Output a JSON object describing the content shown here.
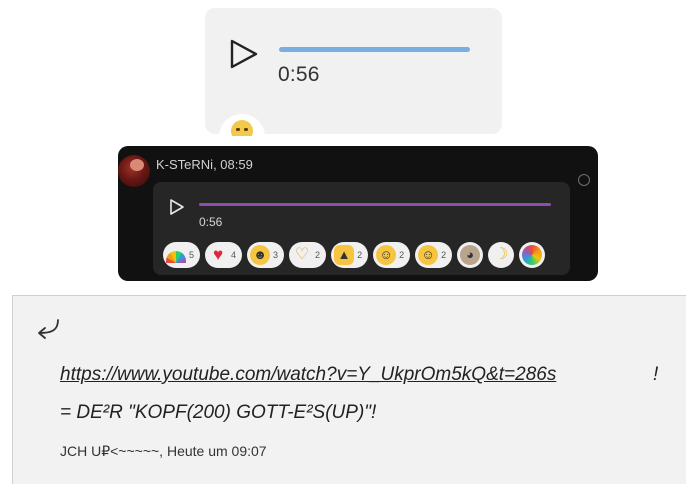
{
  "voice_light": {
    "duration": "0:56",
    "track_color": "#7aaee0"
  },
  "dark_message": {
    "author": "K-STeRNi",
    "time": "08:59",
    "header": "K-STeRNi, 08:59",
    "duration": "0:56",
    "track_color": "#8e4bb0",
    "reactions": [
      {
        "icon": "rainbow-icon",
        "count": "5"
      },
      {
        "icon": "heart-icon",
        "count": "4"
      },
      {
        "icon": "laughing-icon",
        "count": "3"
      },
      {
        "icon": "heart-hands-icon",
        "count": "2"
      },
      {
        "icon": "thumbs-up-icon",
        "count": "2"
      },
      {
        "icon": "tongue-face-icon",
        "count": "2"
      },
      {
        "icon": "grinning-icon",
        "count": "2"
      },
      {
        "icon": "cat-face-icon",
        "count": ""
      },
      {
        "icon": "moon-icon",
        "count": ""
      },
      {
        "icon": "colorful-circle-icon",
        "count": ""
      }
    ]
  },
  "reply": {
    "link": "https://www.youtube.com/watch?v=Y_UkprOm5kQ&t=286s",
    "link_suffix": "!",
    "formula": "= DE²R \"KOPF(200) GOTT-E²S(UP)\"!",
    "meta": "JCH U₽<~~~~~, Heute um 09:07"
  },
  "colors": {
    "dark_bg": "#111111",
    "light_bg": "#f1f1f1",
    "panel_bg": "#f2f2f2"
  }
}
